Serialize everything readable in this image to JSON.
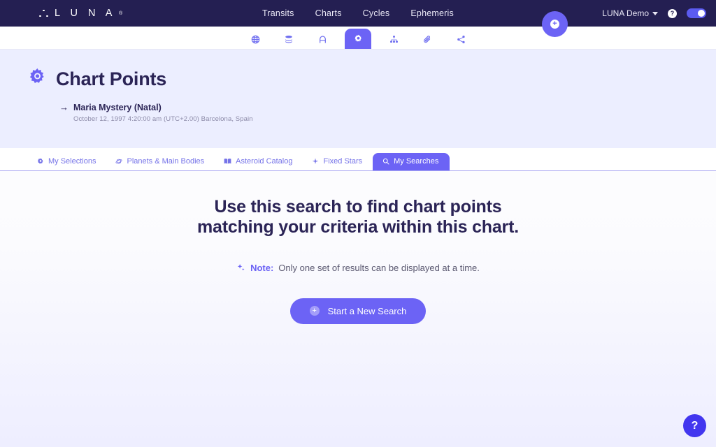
{
  "navbar": {
    "brand": "L U N A",
    "brand_reg": "®",
    "links": [
      {
        "label": "Transits"
      },
      {
        "label": "Charts"
      },
      {
        "label": "Cycles"
      },
      {
        "label": "Ephemeris"
      }
    ],
    "user_menu": "LUNA Demo",
    "help_icon": "question-mark-icon",
    "toggle_state": "on",
    "add_button_icon": "plus-circle-icon",
    "bg_color": "#241f52"
  },
  "icon_toolbar": {
    "items": [
      {
        "name": "globe-icon",
        "active": false
      },
      {
        "name": "layers-icon",
        "active": false
      },
      {
        "name": "letter-a-icon",
        "active": false
      },
      {
        "name": "gear-icon",
        "active": true
      },
      {
        "name": "sitemap-icon",
        "active": false
      },
      {
        "name": "paperclip-icon",
        "active": false
      },
      {
        "name": "share-icon",
        "active": false
      }
    ],
    "accent": "#6c63f5"
  },
  "hero": {
    "icon": "sun-gear-icon",
    "title": "Chart Points",
    "subject_arrow": "→",
    "subject": "Maria Mystery (Natal)",
    "details": "October 12, 1997 4:20:00 am (UTC+2.00) Barcelona, Spain",
    "bg_color": "#eceeff"
  },
  "tabs": [
    {
      "label": "My Selections",
      "icon": "sun-icon",
      "active": false
    },
    {
      "label": "Planets & Main Bodies",
      "icon": "planet-icon",
      "active": false
    },
    {
      "label": "Asteroid Catalog",
      "icon": "book-icon",
      "active": false
    },
    {
      "label": "Fixed Stars",
      "icon": "star-plus-icon",
      "active": false
    },
    {
      "label": "My Searches",
      "icon": "search-icon",
      "active": true
    }
  ],
  "main": {
    "headline_line1": "Use this search to find chart points",
    "headline_line2": "matching your criteria within this chart.",
    "note_icon": "sparkle-icon",
    "note_label": "Note:",
    "note_text": "Only one set of results can be displayed at a time.",
    "cta_label": "Start a New Search",
    "cta_icon": "plus-circle-icon"
  },
  "floating_help": {
    "label": "?",
    "color": "#4236ef"
  }
}
